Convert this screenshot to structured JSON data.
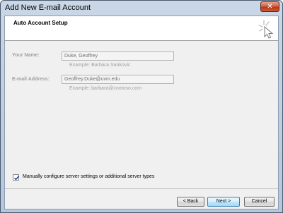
{
  "window": {
    "title": "Add New E-mail Account",
    "close_glyph": "✕"
  },
  "header": {
    "title": "Auto Account Setup",
    "graphic_icon": "mouse-cursor-sparkle-icon"
  },
  "form": {
    "name_label": "Your Name:",
    "name_value": "Duke, Geoffrey",
    "name_example": "Example: Barbara Sankovic",
    "email_label": "E-mail Address:",
    "email_value": "Geoffrey.Duke@uvm.edu",
    "email_example": "Example: barbara@contoso.com"
  },
  "manual_config": {
    "label": "Manually configure server settings or additional server types",
    "checked": true
  },
  "buttons": {
    "back": "< Back",
    "next": "Next >",
    "cancel": "Cancel"
  },
  "colors": {
    "accent_border": "#3c7fb1",
    "disabled_text": "#a0a0a0",
    "close_button": "#c84a2a"
  }
}
